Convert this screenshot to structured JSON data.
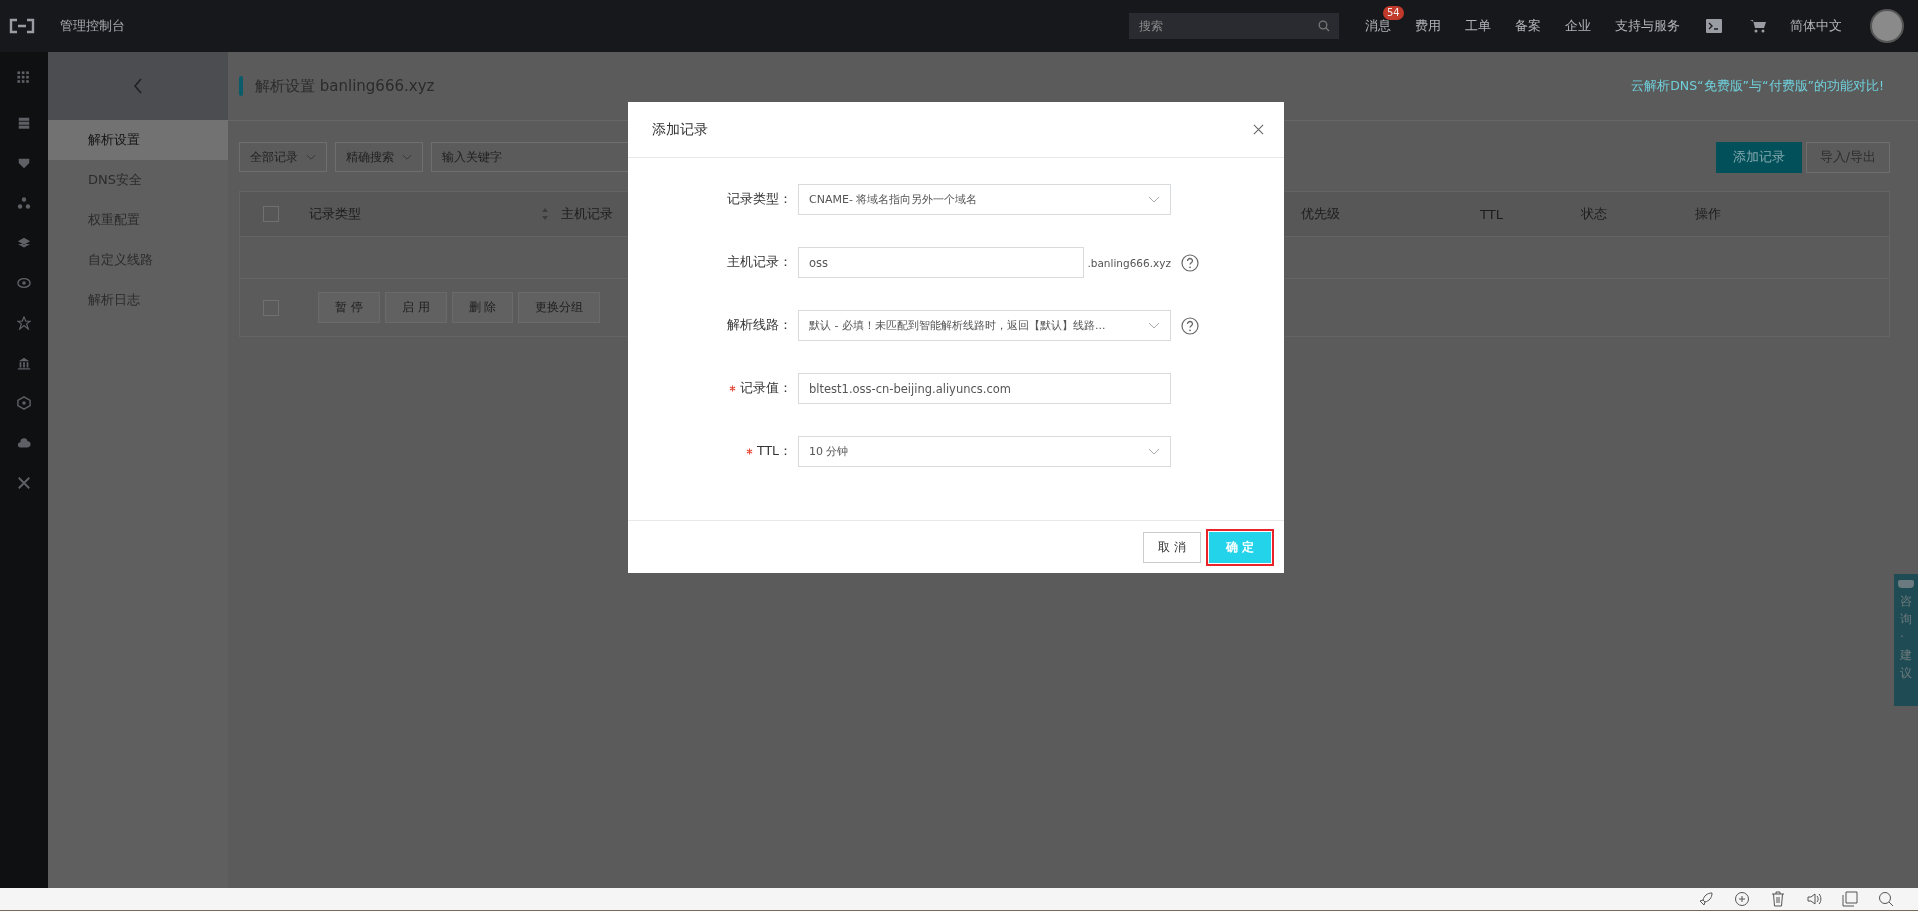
{
  "top_bar": {
    "title": "管理控制台",
    "search": {
      "placeholder": "搜索"
    },
    "nav": [
      {
        "label": "消息",
        "badge": "54"
      },
      {
        "label": "费用"
      },
      {
        "label": "工单"
      },
      {
        "label": "备案"
      },
      {
        "label": "企业"
      },
      {
        "label": "支持与服务"
      }
    ],
    "language": "简体中文"
  },
  "sidebar": {
    "items": [
      {
        "label": "解析设置",
        "selected": true
      },
      {
        "label": "DNS安全",
        "selected": false
      },
      {
        "label": "权重配置",
        "selected": false
      },
      {
        "label": "自定义线路",
        "selected": false
      },
      {
        "label": "解析日志",
        "selected": false
      }
    ]
  },
  "page": {
    "title": "解析设置 banling666.xyz",
    "compare_link": "云解析DNS“免费版”与“付费版”的功能对比!",
    "filters": [
      {
        "label": "全部记录"
      },
      {
        "label": "精确搜索"
      }
    ],
    "search": {
      "placeholder": "输入关键字"
    },
    "actions": [
      {
        "label": "添加记录",
        "primary": true
      },
      {
        "label": "导入/导出",
        "primary": false
      }
    ],
    "table": {
      "select_all_checked": false,
      "columns": [
        {
          "label": "记录类型",
          "sortable": true
        },
        {
          "label": "主机记录",
          "sortable": false
        },
        {
          "label": "优先级",
          "sortable": false
        },
        {
          "label": "TTL",
          "sortable": false
        },
        {
          "label": "状态",
          "sortable": false
        },
        {
          "label": "操作",
          "sortable": false
        }
      ]
    },
    "batch": {
      "checked": false,
      "buttons": [
        {
          "label": "暂 停",
          "disabled": true
        },
        {
          "label": "启 用",
          "disabled": true
        },
        {
          "label": "删 除",
          "disabled": true
        },
        {
          "label": "更换分组",
          "disabled": true
        }
      ]
    }
  },
  "dialog": {
    "title": "添加记录",
    "fields": [
      {
        "kind": "select",
        "label": "记录类型：",
        "required": false,
        "value": "CNAME- 将域名指向另外一个域名",
        "help": false
      },
      {
        "kind": "input",
        "label": "主机记录：",
        "required": false,
        "value": "oss",
        "suffix": ".banling666.xyz",
        "help": true
      },
      {
        "kind": "select",
        "label": "解析线路：",
        "required": false,
        "value": "默认 - 必填！未匹配到智能解析线路时，返回【默认】线路...",
        "help": true
      },
      {
        "kind": "input",
        "label": "记录值：",
        "required": true,
        "value": "bltest1.oss-cn-beijing.aliyuncs.com",
        "help": false
      },
      {
        "kind": "select",
        "label": "TTL：",
        "required": true,
        "value": "10 分钟",
        "help": false
      }
    ],
    "buttons": [
      {
        "label": "取 消",
        "primary": false,
        "highlighted": false
      },
      {
        "label": "确 定",
        "primary": true,
        "highlighted": true
      }
    ]
  },
  "feedback_tab": "咨询·建议"
}
